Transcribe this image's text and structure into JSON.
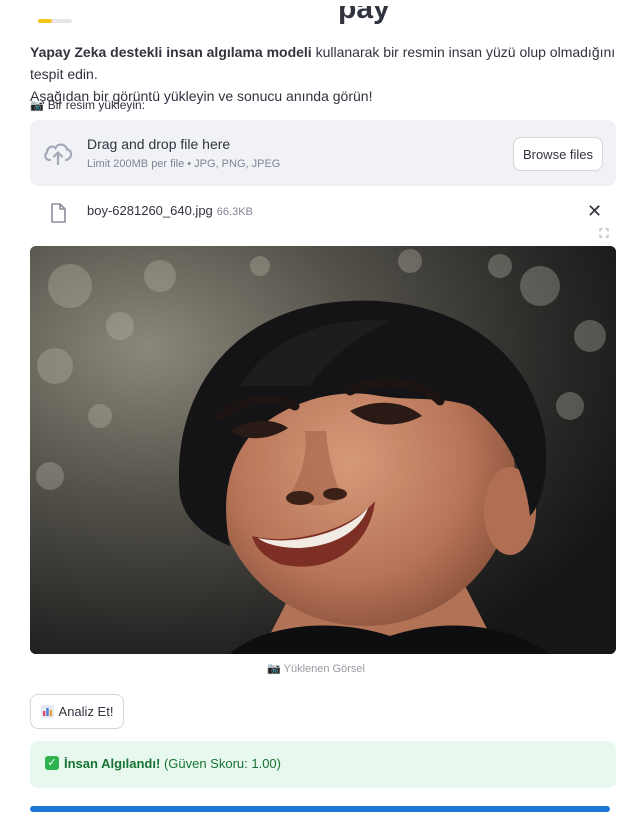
{
  "header": {
    "title_fragment": "pay"
  },
  "description": {
    "bold": "Yapay Zeka destekli insan algılama modeli",
    "rest": " kullanarak bir resmin insan yüzü olup olmadığını tespit edin.",
    "line2": "Aşağıdan bir görüntü yükleyin ve sonucu anında görün!"
  },
  "uploader": {
    "label": "Bir resim yükleyin:",
    "label_icon": "camera-icon",
    "drop_title": "Drag and drop file here",
    "drop_limit": "Limit 200MB per file • JPG, PNG, JPEG",
    "browse_label": "Browse files"
  },
  "file": {
    "name": "boy-6281260_640.jpg",
    "size": "66.3KB",
    "close_label": "✕"
  },
  "image": {
    "caption": "Yüklenen Görsel",
    "caption_icon": "camera-icon"
  },
  "analyze": {
    "label": "Analiz Et!",
    "icon": "bar-chart-icon"
  },
  "result": {
    "title": "İnsan Algılandı!",
    "score_text": "(Güven Skoru: 1.00)",
    "color": "#177233",
    "background": "#e9f8ee"
  },
  "progress": {
    "value": 1.0,
    "color": "#1f77d4"
  },
  "colors": {
    "accent_yellow": "#f5c518",
    "success_green": "#2fb350"
  }
}
